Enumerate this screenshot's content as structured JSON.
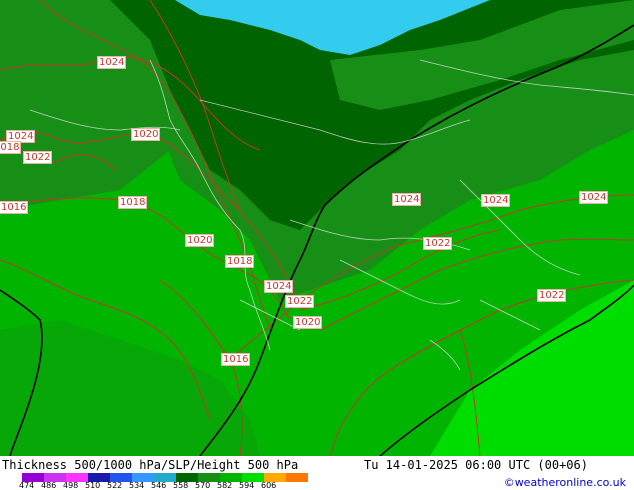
{
  "header": {
    "product": "Thickness 500/1000 hPa/SLP/Height 500 hPa",
    "valid_time": "Tu 14-01-2025 06:00 UTC (00+06)",
    "credit": "©weatheronline.co.uk"
  },
  "legend": {
    "tick_labels": [
      "474",
      "486",
      "498",
      "510",
      "522",
      "534",
      "546",
      "558",
      "570",
      "582",
      "594",
      "606"
    ],
    "colors": [
      "#9400d3",
      "#cc33ee",
      "#ff33ff",
      "#1a1aa8",
      "#2255ee",
      "#3399ff",
      "#22aacc",
      "#006400",
      "#178f17",
      "#00b400",
      "#00dd00",
      "#ffaa00",
      "#ff7700"
    ]
  },
  "map": {
    "isobar_labels": [
      "1024",
      "1024",
      "1018",
      "1022",
      "1020",
      "1016",
      "1018",
      "1020",
      "1018",
      "1024",
      "1022",
      "1020",
      "1016",
      "1024",
      "1022",
      "1024",
      "1024",
      "1022"
    ],
    "colors": {
      "sea": "#33ccee",
      "band_534": "#006400",
      "band_546": "#178f17",
      "band_558": "#00b400",
      "band_570": "#00dd00",
      "isobar": "#c0392b",
      "height_contour": "#000000",
      "borders": "#dddddd"
    }
  }
}
